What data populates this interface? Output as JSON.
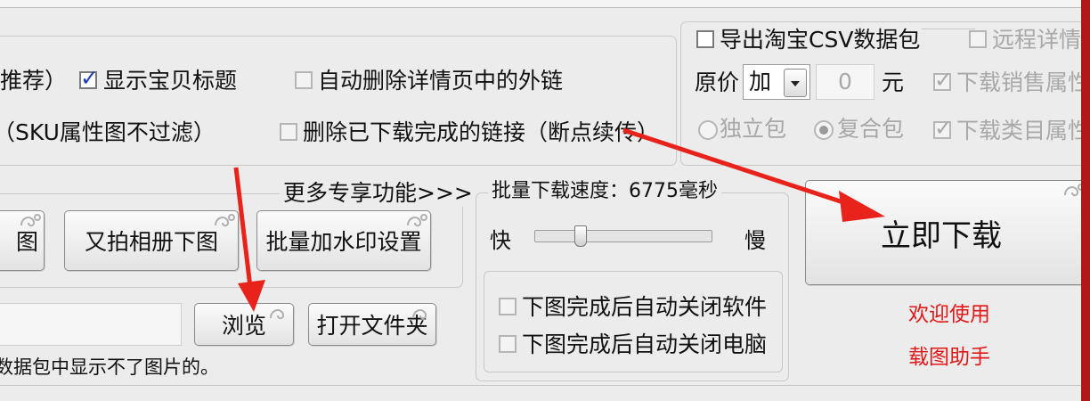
{
  "options": {
    "recommend_partial": "推荐）",
    "show_title": "显示宝贝标题",
    "show_title_checked": true,
    "auto_delete_external_links": "自动删除详情页中的外链",
    "sku_partial": "（SKU属性图不过滤）",
    "delete_downloaded_links": "删除已下载完成的链接（断点续传）"
  },
  "export_panel": {
    "export_taobao_csv": "导出淘宝CSV数据包",
    "remote_detail_partial": "远程详情",
    "original_price_label": "原价",
    "price_op": "加",
    "price_value": "0",
    "price_unit": "元",
    "download_sales_attr_partial": "下载销售属性",
    "download_category_attr_partial": "下载类目属性",
    "independent_package": "独立包",
    "compound_package": "复合包"
  },
  "functions": {
    "group_title": "更多专享功能>>>",
    "left_button_partial": "图",
    "youpai_album_download": "又拍相册下图",
    "batch_watermark_settings": "批量加水印设置"
  },
  "path": {
    "browse": "浏览",
    "open_folder": "打开文件夹",
    "note_partial": "数据包中显示不了图片的。"
  },
  "speed": {
    "title": "批量下载速度：6775毫秒",
    "fast": "快",
    "slow": "慢",
    "level": 0.26,
    "auto_close_software": "下图完成后自动关闭软件",
    "auto_close_computer": "下图完成后自动关闭电脑"
  },
  "actions": {
    "download_now": "立即下载",
    "welcome_line1": "欢迎使用",
    "welcome_line2": "载图助手"
  },
  "colors": {
    "annotation_arrow": "#e8231b",
    "welcome_text": "#e01818"
  }
}
